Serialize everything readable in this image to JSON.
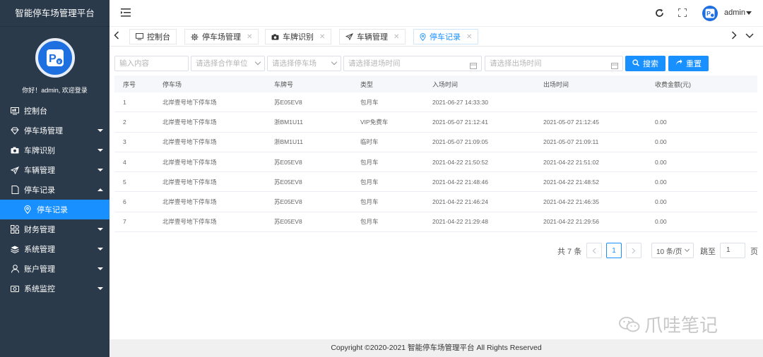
{
  "sidebar": {
    "brand": "智能停车场管理平台",
    "welcome": "你好！admin, 欢迎登录",
    "items": [
      {
        "label": "控制台"
      },
      {
        "label": "停车场管理"
      },
      {
        "label": "车牌识别"
      },
      {
        "label": "车辆管理"
      },
      {
        "label": "停车记录"
      },
      {
        "label": "停车记录"
      },
      {
        "label": "财务管理"
      },
      {
        "label": "系统管理"
      },
      {
        "label": "账户管理"
      },
      {
        "label": "系统监控"
      }
    ]
  },
  "header": {
    "username": "admin"
  },
  "tabs": [
    {
      "label": "控制台"
    },
    {
      "label": "停车场管理"
    },
    {
      "label": "车牌识别"
    },
    {
      "label": "车辆管理"
    },
    {
      "label": "停车记录"
    }
  ],
  "filters": {
    "keyword_placeholder": "输入内容",
    "partner_placeholder": "请选择合作单位",
    "lot_placeholder": "请选择停车场",
    "entry_placeholder": "请选择进场时间",
    "exit_placeholder": "请选择出场时间",
    "search_label": "搜索",
    "reset_label": "重置"
  },
  "table": {
    "headers": [
      "序号",
      "停车场",
      "车牌号",
      "类型",
      "入场时间",
      "出场时间",
      "收费金额(元)"
    ],
    "rows": [
      [
        "1",
        "北岸壹号地下停车场",
        "苏E05EV8",
        "包月车",
        "2021-06-27 14:33:30",
        "",
        ""
      ],
      [
        "2",
        "北岸壹号地下停车场",
        "浙BM1U11",
        "VIP免费车",
        "2021-05-07 21:12:41",
        "2021-05-07 21:12:45",
        "0.00"
      ],
      [
        "3",
        "北岸壹号地下停车场",
        "浙BM1U11",
        "临时车",
        "2021-05-07 21:09:05",
        "2021-05-07 21:09:11",
        "0.00"
      ],
      [
        "4",
        "北岸壹号地下停车场",
        "苏E05EV8",
        "包月车",
        "2021-04-22 21:50:52",
        "2021-04-22 21:51:02",
        "0.00"
      ],
      [
        "5",
        "北岸壹号地下停车场",
        "苏E05EV8",
        "包月车",
        "2021-04-22 21:48:46",
        "2021-04-22 21:48:52",
        "0.00"
      ],
      [
        "6",
        "北岸壹号地下停车场",
        "苏E05EV8",
        "包月车",
        "2021-04-22 21:46:24",
        "2021-04-22 21:46:35",
        "0.00"
      ],
      [
        "7",
        "北岸壹号地下停车场",
        "苏E05EV8",
        "包月车",
        "2021-04-22 21:29:48",
        "2021-04-22 21:29:56",
        "0.00"
      ]
    ]
  },
  "pager": {
    "total": "共 7 条",
    "current": "1",
    "page_size": "10 条/页",
    "jump_label": "跳至",
    "jump_value": "1",
    "page_unit": "页"
  },
  "watermark": "爪哇笔记",
  "footer": "Copyright ©2020-2021 智能停车场管理平台 All Rights Reserved",
  "colors": {
    "sidebar_bg": "#2b3a4a",
    "accent": "#1890ff",
    "avatar": "#1e6fe0"
  }
}
